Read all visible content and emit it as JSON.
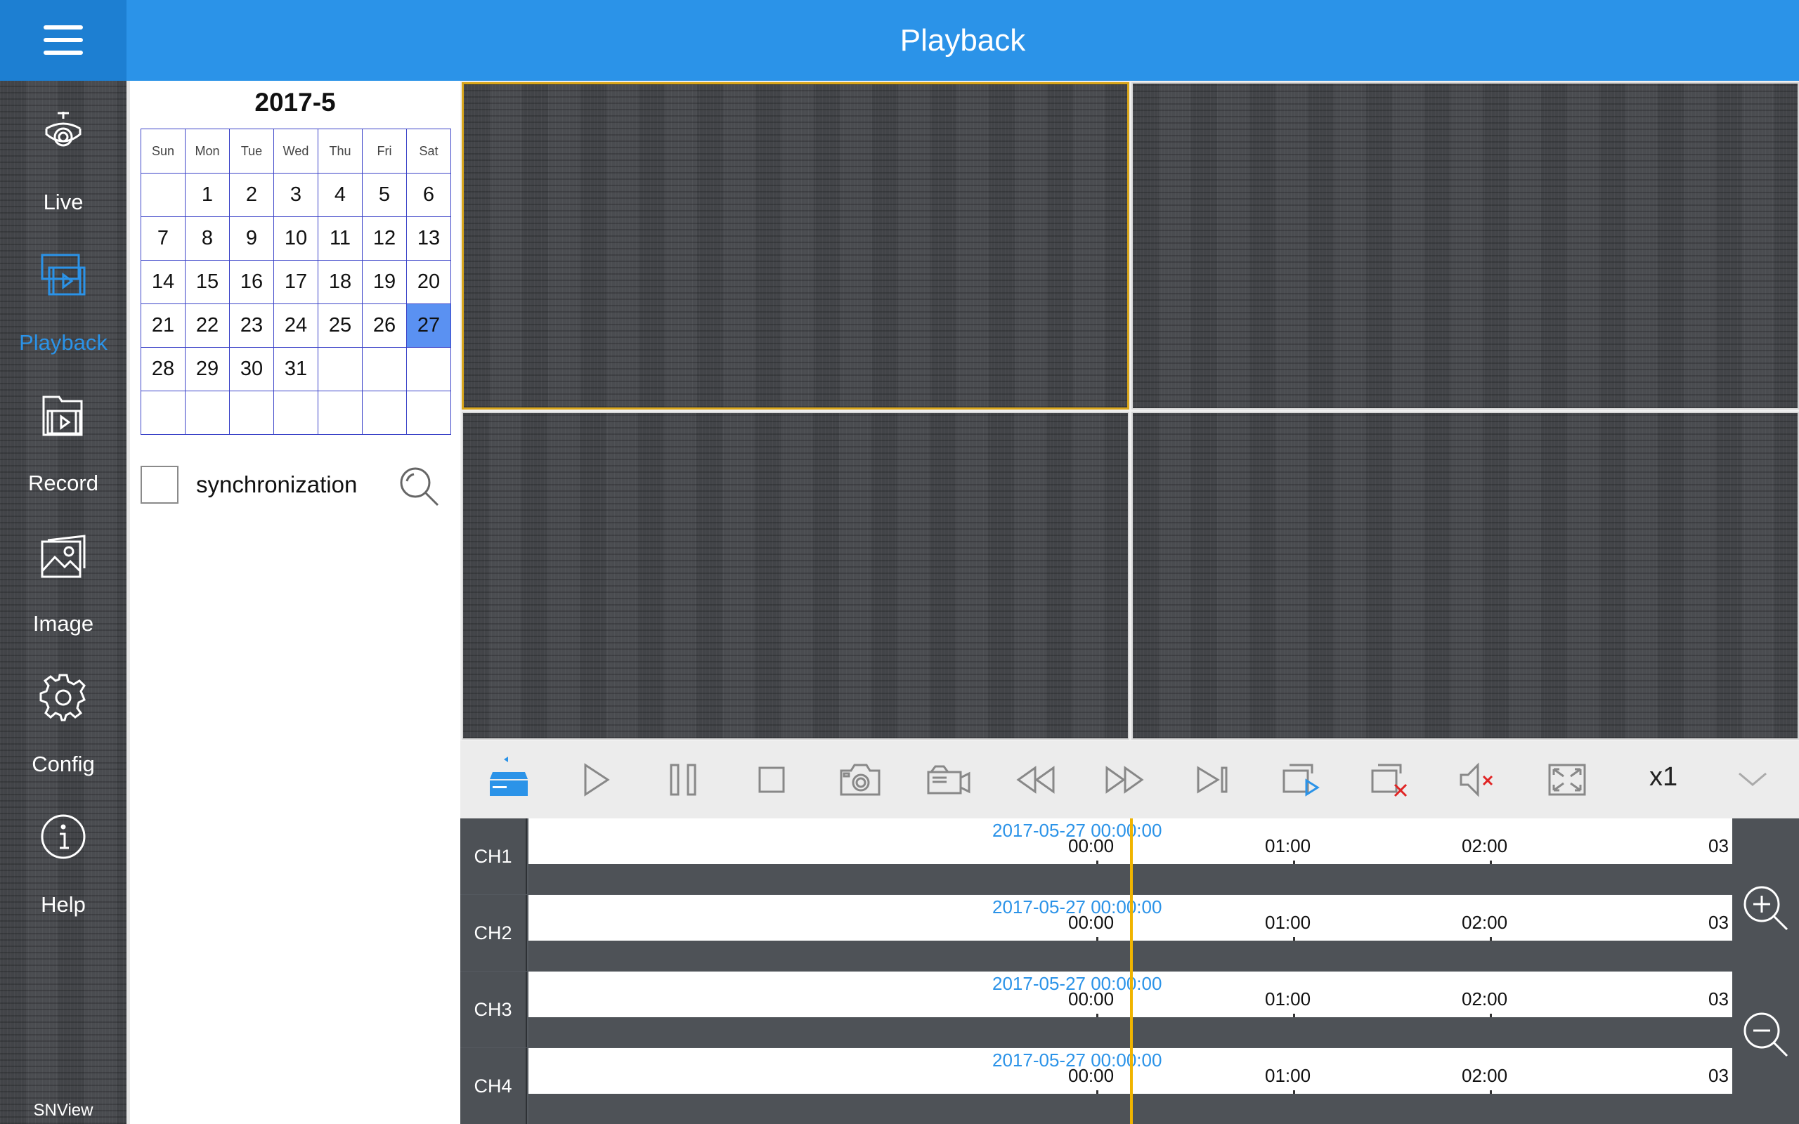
{
  "header": {
    "title": "Playback"
  },
  "sidebar": {
    "items": [
      {
        "label": "Live",
        "icon": "camera-icon"
      },
      {
        "label": "Playback",
        "icon": "playback-icon"
      },
      {
        "label": "Record",
        "icon": "record-icon"
      },
      {
        "label": "Image",
        "icon": "image-icon"
      },
      {
        "label": "Config",
        "icon": "gear-icon"
      },
      {
        "label": "Help",
        "icon": "info-icon"
      }
    ],
    "brand": "SNView"
  },
  "calendar": {
    "title": "2017-5",
    "weekdays": [
      "Sun",
      "Mon",
      "Tue",
      "Wed",
      "Thu",
      "Fri",
      "Sat"
    ],
    "weeks": [
      [
        "",
        "1",
        "2",
        "3",
        "4",
        "5",
        "6"
      ],
      [
        "7",
        "8",
        "9",
        "10",
        "11",
        "12",
        "13"
      ],
      [
        "14",
        "15",
        "16",
        "17",
        "18",
        "19",
        "20"
      ],
      [
        "21",
        "22",
        "23",
        "24",
        "25",
        "26",
        "27"
      ],
      [
        "28",
        "29",
        "30",
        "31",
        "",
        "",
        ""
      ],
      [
        "",
        "",
        "",
        "",
        "",
        "",
        ""
      ]
    ],
    "selected_day": "27",
    "sync_label": "synchronization",
    "sync_checked": false
  },
  "toolbar": {
    "buttons": [
      "device-icon",
      "play-icon",
      "pause-icon",
      "stop-icon",
      "snapshot-icon",
      "record-clip-icon",
      "rewind-icon",
      "fast-forward-icon",
      "next-frame-icon",
      "playback-all-icon",
      "close-all-icon",
      "mute-icon",
      "fullscreen-icon"
    ],
    "speed": "x1",
    "collapse_icon": "chevron-down-icon"
  },
  "timeline": {
    "channels": [
      {
        "name": "CH1",
        "date": "2017-05-27 00:00:00"
      },
      {
        "name": "CH2",
        "date": "2017-05-27 00:00:00"
      },
      {
        "name": "CH3",
        "date": "2017-05-27 00:00:00"
      },
      {
        "name": "CH4",
        "date": "2017-05-27 00:00:00"
      }
    ],
    "ticks": [
      "00:00",
      "01:00",
      "02:00",
      "03"
    ],
    "accent": "#2b93e8",
    "playhead_color": "#f0b400"
  }
}
